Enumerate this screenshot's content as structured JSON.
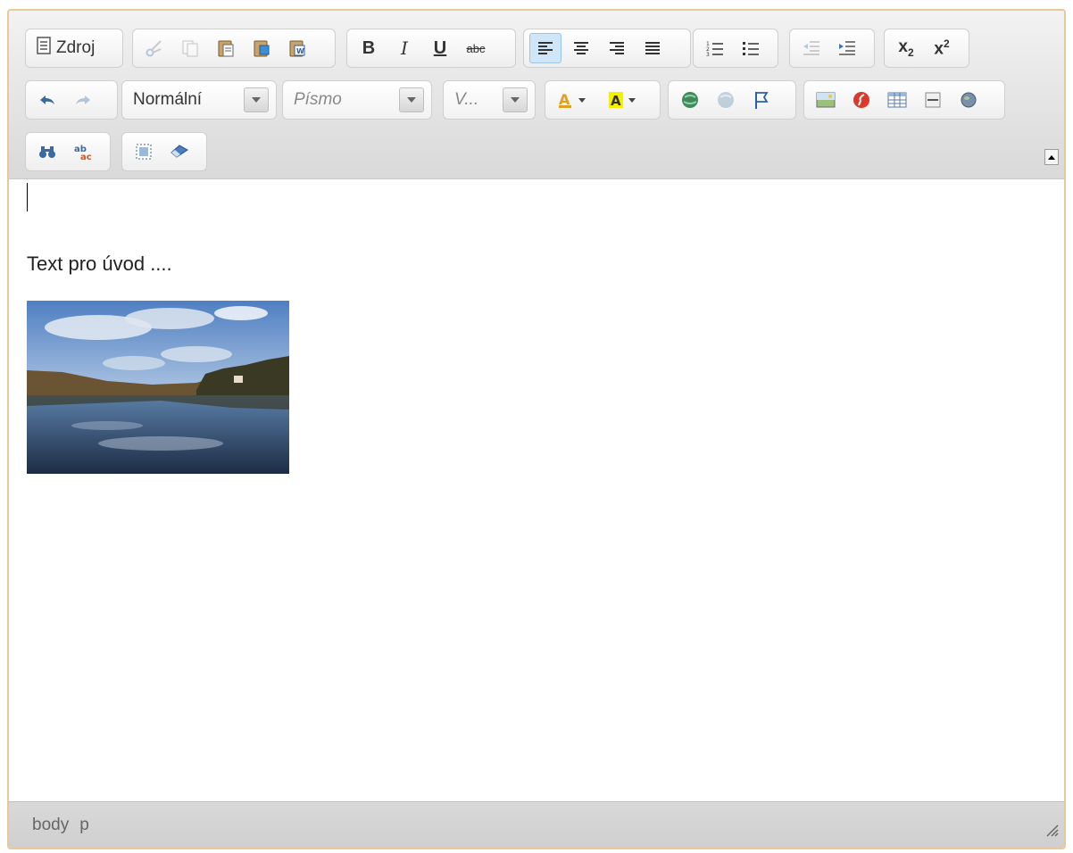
{
  "toolbar": {
    "source_label": "Zdroj",
    "format_combo": "Normální",
    "font_combo": "Písmo",
    "size_combo": "V..."
  },
  "content": {
    "paragraph": "Text pro úvod ...."
  },
  "statusbar": {
    "path": [
      "body",
      "p"
    ]
  },
  "colors": {
    "border": "#e8c99a",
    "toolbar_bg": "#dcdcdc",
    "active_button": "#cfe5f8"
  }
}
